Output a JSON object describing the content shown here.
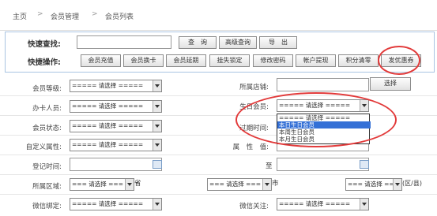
{
  "breadcrumb": {
    "home": "主页",
    "sep1": ">",
    "module": "会员管理",
    "sep2": ">",
    "page": "会员列表"
  },
  "quick": {
    "search_label": "快速查找:",
    "search_value": "",
    "query_btn": "查　询",
    "advanced_btn": "高级查询",
    "export_btn": "导　出",
    "ops_label": "快捷操作:",
    "ops": [
      "会员充值",
      "会员换卡",
      "会员延期",
      "挂失锁定",
      "修改密码",
      "帐户提现",
      "积分清零",
      "发优惠券"
    ]
  },
  "form": {
    "level_label": "会员等级:",
    "level_value": "===== 请选择 =====",
    "store_label": "所属店铺:",
    "store_btn": "选择",
    "agent_label": "办卡人员:",
    "agent_value": "===== 请选择 =====",
    "birthday_label": "生日会员:",
    "birthday_value": "===== 请选择 =====",
    "birthday_options": [
      "===== 请选择 =====",
      "本日生日会员",
      "本周生日会员",
      "本月生日会员"
    ],
    "status_label": "会员状态:",
    "status_value": "===== 请选择 =====",
    "expire_label": "过期时间:",
    "custom_label": "自定义属性:",
    "custom_value": "===== 请选择 =====",
    "attr_label": "属　性　值:",
    "regtime_label": "登记时间:",
    "to_label": "至",
    "region_label": "所属区域:",
    "province_value": "=== 请选择 ===",
    "province_unit": "省",
    "city_value": "=== 请选择 ===",
    "city_unit": "市",
    "district_value": "=== 请选择 ===",
    "district_unit": "(区/县)",
    "wechat_bind_label": "微信绑定:",
    "wechat_bind_value": "===== 请选择 =====",
    "wechat_follow_label": "微信关注:",
    "wechat_follow_value": "===== 请选择 ====="
  },
  "colors": {
    "annotation": "#e23a3a",
    "highlight": "#3470d6",
    "panel_border": "#a9c4e2"
  }
}
